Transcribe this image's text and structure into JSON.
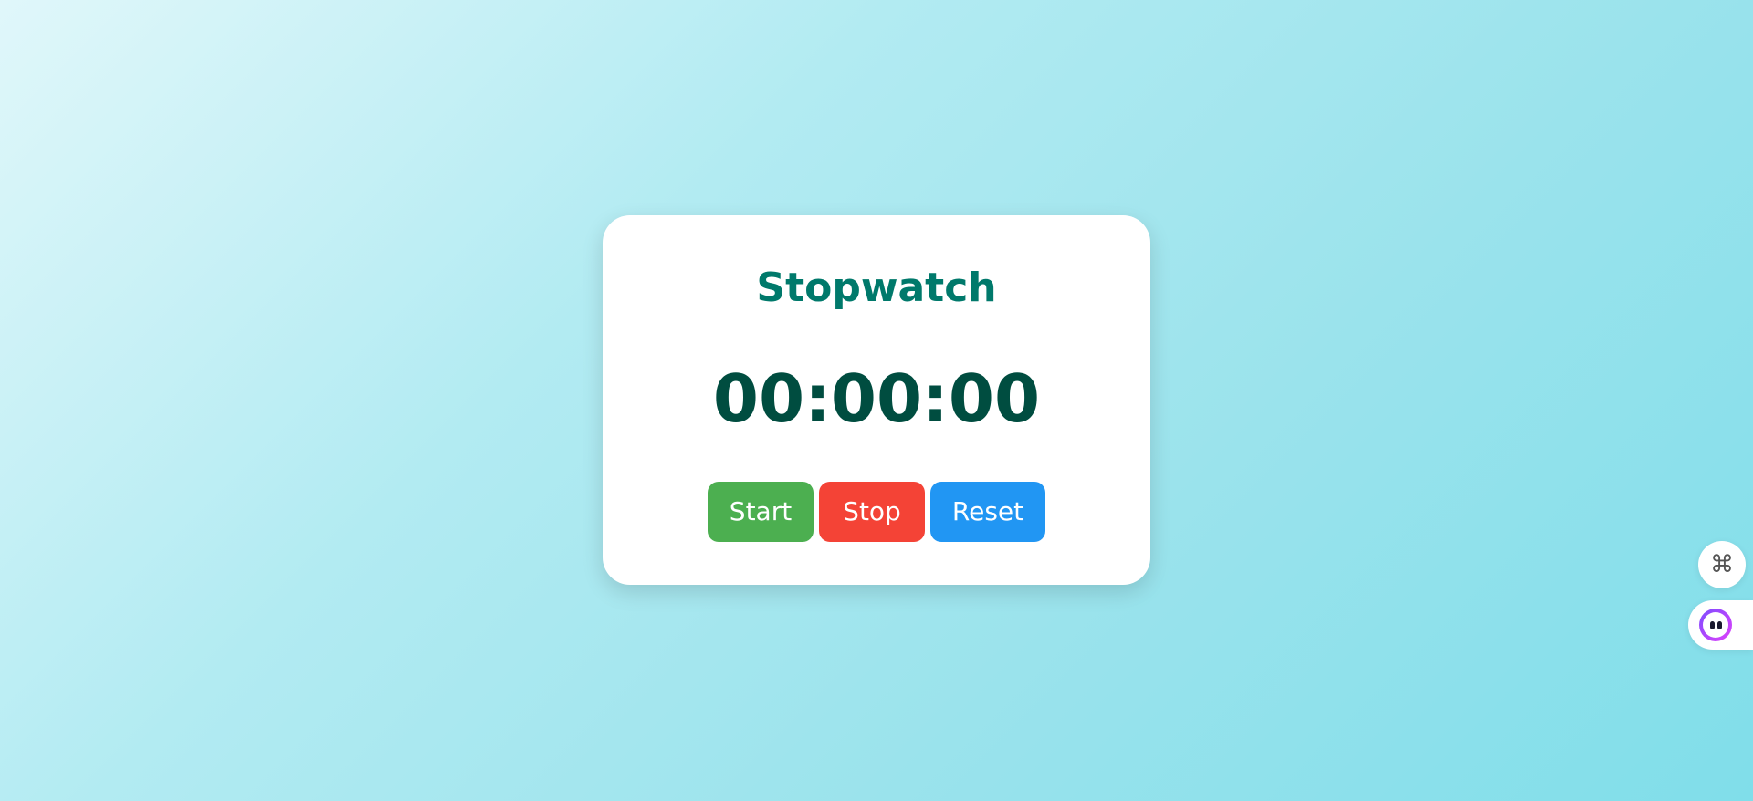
{
  "app": {
    "title": "Stopwatch",
    "time_display": "00:00:00"
  },
  "controls": {
    "start_label": "Start",
    "stop_label": "Stop",
    "reset_label": "Reset"
  },
  "colors": {
    "title": "#00796b",
    "time": "#004d40",
    "start": "#4caf50",
    "stop": "#f44336",
    "reset": "#2196f3"
  },
  "floating_widgets": {
    "command_icon": "⌘",
    "command_icon_name": "command-icon",
    "assistant_icon_name": "assistant-avatar-icon"
  }
}
